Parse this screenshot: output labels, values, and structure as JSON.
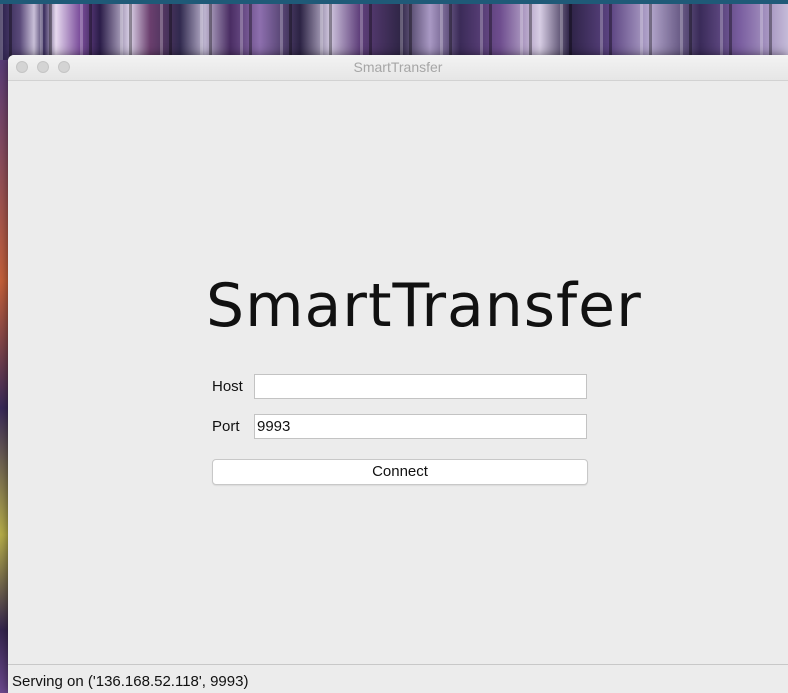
{
  "window": {
    "title": "SmartTransfer"
  },
  "main": {
    "heading": "SmartTransfer",
    "host_label": "Host",
    "host_value": "",
    "port_label": "Port",
    "port_value": "9993",
    "connect_label": "Connect"
  },
  "status": {
    "text": "Serving on ('136.168.52.118', 9993)"
  },
  "icons": [
    "close-button-icon",
    "minimize-button-icon",
    "zoom-button-icon"
  ],
  "colors": {
    "window_bg": "#ececec",
    "titlebar_text": "#a6a6a6",
    "text": "#111111"
  }
}
